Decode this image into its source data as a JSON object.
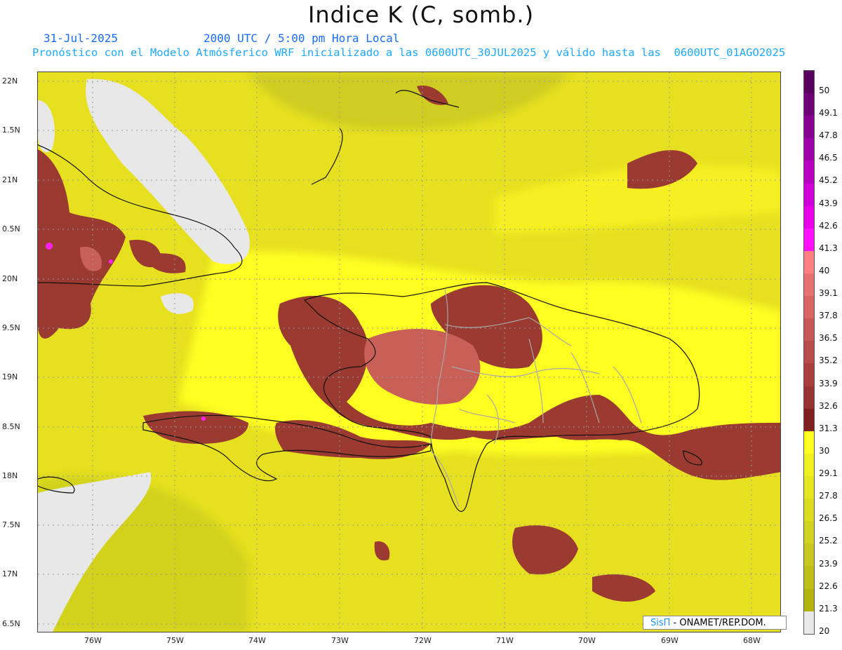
{
  "header": {
    "title": "Indice K (C, somb.)",
    "date": "31-Jul-2025",
    "valid_time": "2000 UTC / 5:00 pm Hora Local",
    "description": "Pronóstico con el Modelo Atmósferico WRF inicializado a las 0600UTC_30JUL2025 y válido hasta las  0600UTC_01AGO2025"
  },
  "axes": {
    "lon_labels": [
      "76W",
      "75W",
      "74W",
      "73W",
      "72W",
      "71W",
      "70W",
      "69W",
      "68W"
    ],
    "lat_labels": [
      "22N",
      "1.5N",
      "21N",
      "0.5N",
      "20N",
      "9.5N",
      "19N",
      "8.5N",
      "18N",
      "7.5N",
      "17N",
      "6.5N"
    ]
  },
  "colorbar": {
    "labels": [
      "50",
      "49.1",
      "47.8",
      "46.5",
      "45.2",
      "43.9",
      "42.6",
      "41.3",
      "40",
      "39.1",
      "37.8",
      "36.5",
      "35.2",
      "33.9",
      "32.6",
      "31.3",
      "30",
      "29.1",
      "27.8",
      "26.5",
      "25.2",
      "23.9",
      "22.6",
      "21.3",
      "20"
    ],
    "colors": [
      "#5a0060",
      "#6e0078",
      "#880090",
      "#a000a8",
      "#b800c0",
      "#d000d8",
      "#e800e8",
      "#ff10ff",
      "#ff8080",
      "#e87272",
      "#d86464",
      "#c85858",
      "#b84c4c",
      "#a84040",
      "#983434",
      "#802020",
      "#ffff20",
      "#f0f020",
      "#e6e620",
      "#dcdc20",
      "#d2d220",
      "#c8c820",
      "#bebe18",
      "#b4b410",
      "#e8e8e8"
    ]
  },
  "credit": {
    "brand": "SisΠ",
    "text": " - ONAMET/REP.DOM."
  }
}
